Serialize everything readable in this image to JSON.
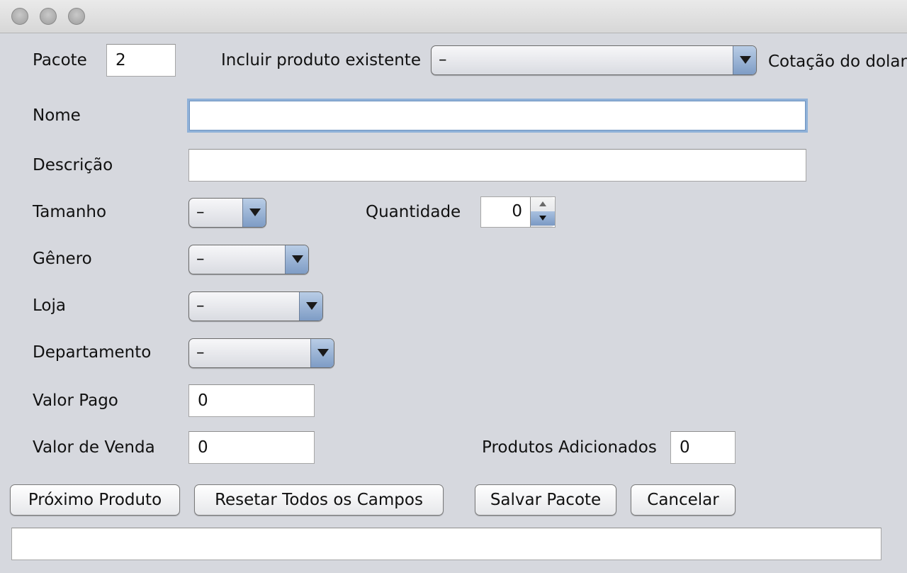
{
  "header": {
    "pacote_label": "Pacote",
    "pacote_value": "2",
    "incluir_label": "Incluir produto existente",
    "incluir_value": "–",
    "cotacao_label": "Cotação do dolar"
  },
  "form": {
    "nome_label": "Nome",
    "nome_value": "",
    "descricao_label": "Descrição",
    "descricao_value": "",
    "tamanho_label": "Tamanho",
    "tamanho_value": "–",
    "quantidade_label": "Quantidade",
    "quantidade_value": "0",
    "genero_label": "Gênero",
    "genero_value": "–",
    "loja_label": "Loja",
    "loja_value": "–",
    "departamento_label": "Departamento",
    "departamento_value": "–",
    "valor_pago_label": "Valor Pago",
    "valor_pago_value": "0",
    "valor_venda_label": "Valor de Venda",
    "valor_venda_value": "0",
    "produtos_adicionados_label": "Produtos Adicionados",
    "produtos_adicionados_value": "0"
  },
  "buttons": {
    "proximo": "Próximo Produto",
    "resetar": "Resetar Todos os Campos",
    "salvar": "Salvar Pacote",
    "cancelar": "Cancelar"
  },
  "status": {
    "message": ""
  },
  "colors": {
    "window_bg": "#d6d8de",
    "combo_arrow": "#7e9cc5",
    "focus_ring": "#8fb1d8"
  }
}
